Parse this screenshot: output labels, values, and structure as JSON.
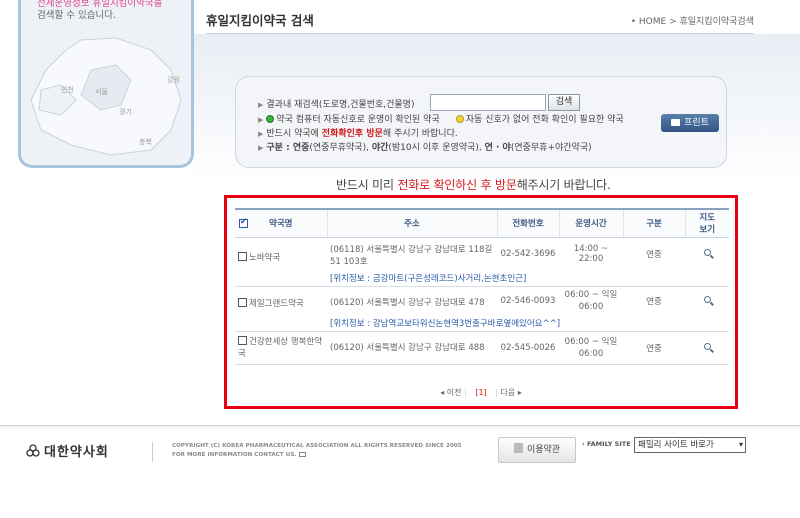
{
  "map_panel": {
    "hint_line1": "전세운영정보 휴일지킴이약국을",
    "hint_line2": "검색할 수 있습니다.",
    "regions": [
      "강원",
      "인천",
      "서울",
      "경기",
      "충북"
    ]
  },
  "header": {
    "title": "휴일지킴이약국 검색",
    "breadcrumb": "• HOME > 휴일지킴이약국검색"
  },
  "search": {
    "label": "결과내 재검색(도로명,건물번호,건물명)",
    "input_value": "",
    "button_label": "검색",
    "legend_green": "약국 컴퓨터 자동신호로 운영이 확인된 약국",
    "legend_yellow": "자동 신호가 없어 전화 확인이 필요한 약국",
    "notice_pre": "반드시 약국에 ",
    "notice_red": "전화확인후 방문",
    "notice_post": "해 주시기 바랍니다.",
    "category_label": "구분 : ",
    "category_1": "연중",
    "category_1_desc": "(연중무휴약국), ",
    "category_2": "야간",
    "category_2_desc": "(밤10시 이후 운영약국), ",
    "category_3": "연 · 야",
    "category_3_desc": "(연중무휴+야간약국)",
    "print_label": "프린트"
  },
  "notice": {
    "pre": "반드시 미리 ",
    "red": "전화로 확인하신 후 방문",
    "post": "해주시기 바랍니다."
  },
  "table": {
    "headers": {
      "name": "약국명",
      "address": "주소",
      "phone": "전화번호",
      "hours": "운영시간",
      "category": "구분",
      "map_line1": "지도",
      "map_line2": "보기"
    },
    "rows": [
      {
        "name": "노바약국",
        "address": "(06118) 서울특별시 강남구 강남대로 118길 51 103호",
        "phone": "02-542-3696",
        "hours": "14:00 ~ 22:00",
        "category": "연중",
        "location": "[위치정보 : 금강마트(구은성레코드)사거리,논현초인근]"
      },
      {
        "name": "제일그랜드약국",
        "address": "(06120) 서울특별시 강남구 강남대로 478",
        "phone": "02-546-0093",
        "hours": "06:00 ~ 익일 06:00",
        "category": "연중",
        "location": "[위치정보 : 강남역교보타워신논현역3번출구바로옆에있어요^^]"
      },
      {
        "name": "건강한세상 행복한약국",
        "address": "(06120) 서울특별시 강남구 강남대로 488",
        "phone": "02-545-0026",
        "hours": "06:00 ~ 익일 06:00",
        "category": "연중",
        "location": ""
      }
    ]
  },
  "pager": {
    "prev": "◂ 이전",
    "current": "[1]",
    "next": "다음 ▸"
  },
  "footer": {
    "logo_text": "대한약사회",
    "copyright_line1": "COPYRIGHT (C) KOREA PHARMACEUTICAL ASSOCIATION ALL RIGHTS RESERVED SINCE 2005",
    "copyright_line2": "FOR MORE INFORMATION CONTACT US.",
    "terms_label": "이용약관",
    "family_label": "FAMILY SITE",
    "family_select": "패밀리 사이트 바로가"
  },
  "colors": {
    "accent_red": "#d31b1b",
    "highlight_frame": "#e60012",
    "header_blue": "#3c5a84",
    "print_button": "#3a5f8f"
  },
  "icons": [
    "envelope-icon",
    "magnifier-icon",
    "printer-icon",
    "document-icon",
    "logo-mark-icon"
  ]
}
